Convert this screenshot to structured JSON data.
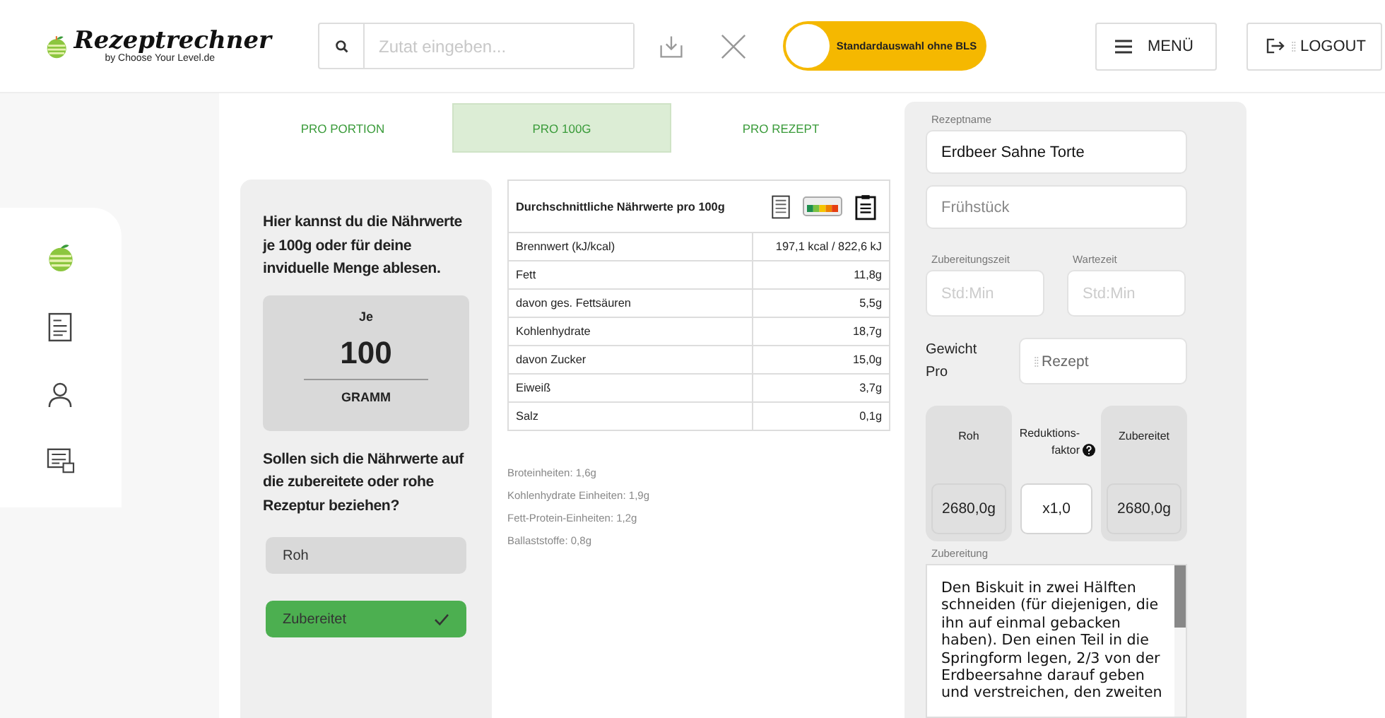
{
  "header": {
    "logo": {
      "name": "Rezeptrechner",
      "tagline": "by Choose Your Level.de"
    },
    "search": {
      "placeholder": "Zutat eingeben..."
    },
    "toggle": {
      "label": "Standardauswahl ohne BLS",
      "on": true
    },
    "menu_button": "MENÜ",
    "logout_button": "LOGOUT"
  },
  "tabs": [
    {
      "label": "PRO PORTION",
      "selected": false
    },
    {
      "label": "PRO 100G",
      "selected": true
    },
    {
      "label": "PRO REZEPT",
      "selected": false
    }
  ],
  "info_card": {
    "intro": "Hier kannst du die Nährwerte je 100g oder für deine inviduelle Menge ablesen.",
    "amount": {
      "label": "Je",
      "value": "100",
      "unit": "GRAMM"
    },
    "question": "Sollen sich die Nährwerte auf die zubereitete oder rohe Rezeptur beziehen?",
    "options": [
      {
        "label": "Roh",
        "selected": false
      },
      {
        "label": "Zubereitet",
        "selected": true
      }
    ]
  },
  "nutrition_table": {
    "title": "Durchschnittliche Nährwerte pro 100g",
    "rows": [
      {
        "name": "Brennwert (kJ/kcal)",
        "value": "197,1 kcal / 822,6 kJ"
      },
      {
        "name": "Fett",
        "value": "11,8g"
      },
      {
        "name": "davon ges. Fettsäuren",
        "value": "5,5g"
      },
      {
        "name": "Kohlenhydrate",
        "value": "18,7g"
      },
      {
        "name": "davon Zucker",
        "value": "15,0g"
      },
      {
        "name": "Eiweiß",
        "value": "3,7g"
      },
      {
        "name": "Salz",
        "value": "0,1g"
      }
    ]
  },
  "extra_values": [
    "Broteinheiten: 1,6g",
    "Kohlenhydrate Einheiten: 1,9g",
    "Fett-Protein-Einheiten: 1,2g",
    "Ballaststoffe: 0,8g"
  ],
  "recipe_panel": {
    "name_label": "Rezeptname",
    "name_value": "Erdbeer Sahne Torte",
    "category_value": "Frühstück",
    "prep_time": {
      "label": "Zubereitungszeit",
      "placeholder": "Std:Min"
    },
    "wait_time": {
      "label": "Wartezeit",
      "placeholder": "Std:Min"
    },
    "weight_label": "Gewicht Pro",
    "weight_value": "Rezept",
    "raw": {
      "label": "Roh",
      "value": "2680,0g"
    },
    "factor": {
      "label": "Reduktions-faktor",
      "value": "x1,0"
    },
    "cooked": {
      "label": "Zubereitet",
      "value": "2680,0g"
    },
    "instructions": {
      "label": "Zubereitung",
      "text": "Den Biskuit in zwei Hälften schneiden (für diejenigen, die ihn auf einmal gebacken haben). Den einen Teil in die Springform legen, 2/3 von der Erdbeersahne darauf geben und verstreichen, den zweiten"
    }
  }
}
